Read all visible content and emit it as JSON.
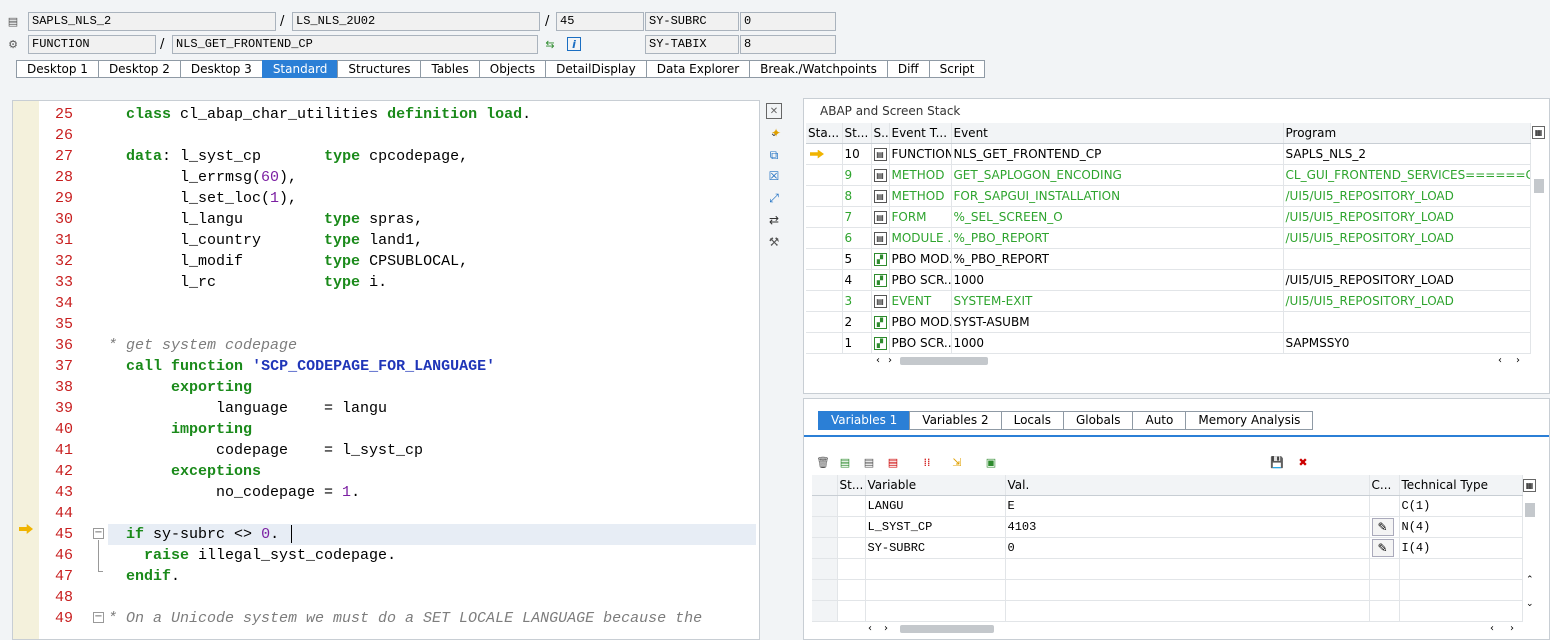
{
  "header": {
    "program": "SAPLS_NLS_2",
    "include": "LS_NLS_2U02",
    "line": "45",
    "subrc_label": "SY-SUBRC",
    "subrc_value": "0",
    "event_type": "FUNCTION",
    "event_name": "NLS_GET_FRONTEND_CP",
    "tabix_label": "SY-TABIX",
    "tabix_value": "8",
    "separator": "/"
  },
  "tabs": [
    "Desktop 1",
    "Desktop 2",
    "Desktop 3",
    "Standard",
    "Structures",
    "Tables",
    "Objects",
    "DetailDisplay",
    "Data Explorer",
    "Break./Watchpoints",
    "Diff",
    "Script"
  ],
  "active_tab": "Standard",
  "editor": {
    "current_line": 45,
    "lines": [
      {
        "n": "25",
        "t": "  class cl_abap_char_utilities definition load."
      },
      {
        "n": "26",
        "t": ""
      },
      {
        "n": "27",
        "t": "  data: l_syst_cp       type cpcodepage,"
      },
      {
        "n": "28",
        "t": "        l_errmsg(60),"
      },
      {
        "n": "29",
        "t": "        l_set_loc(1),"
      },
      {
        "n": "30",
        "t": "        l_langu         type spras,"
      },
      {
        "n": "31",
        "t": "        l_country       type land1,"
      },
      {
        "n": "32",
        "t": "        l_modif         type CPSUBLOCAL,"
      },
      {
        "n": "33",
        "t": "        l_rc            type i."
      },
      {
        "n": "34",
        "t": ""
      },
      {
        "n": "35",
        "t": ""
      },
      {
        "n": "36",
        "t": "* get system codepage"
      },
      {
        "n": "37",
        "t": "  call function 'SCP_CODEPAGE_FOR_LANGUAGE'"
      },
      {
        "n": "38",
        "t": "       exporting"
      },
      {
        "n": "39",
        "t": "            language    = langu"
      },
      {
        "n": "40",
        "t": "       importing"
      },
      {
        "n": "41",
        "t": "            codepage    = l_syst_cp"
      },
      {
        "n": "42",
        "t": "       exceptions"
      },
      {
        "n": "43",
        "t": "            no_codepage = 1."
      },
      {
        "n": "44",
        "t": ""
      },
      {
        "n": "45",
        "t": "  if sy-subrc <> 0."
      },
      {
        "n": "46",
        "t": "    raise illegal_syst_codepage."
      },
      {
        "n": "47",
        "t": "  endif."
      },
      {
        "n": "48",
        "t": ""
      },
      {
        "n": "49",
        "t": "* On a Unicode system we must do a SET LOCALE LANGUAGE because the"
      }
    ]
  },
  "stack": {
    "title": "ABAP and Screen Stack",
    "columns": [
      "Sta...",
      "St...",
      "S...",
      "Event T...",
      "Event",
      "Program"
    ],
    "rows": [
      {
        "sta": "arrow",
        "st": "10",
        "type": "FUNCTION",
        "event": "NLS_GET_FRONTEND_CP",
        "program": "SAPLS_NLS_2",
        "green": false
      },
      {
        "sta": "",
        "st": "9",
        "type": "METHOD",
        "event": "GET_SAPLOGON_ENCODING",
        "program": "CL_GUI_FRONTEND_SERVICES======CP",
        "green": true
      },
      {
        "sta": "",
        "st": "8",
        "type": "METHOD",
        "event": "FOR_SAPGUI_INSTALLATION",
        "program": "/UI5/UI5_REPOSITORY_LOAD",
        "green": true
      },
      {
        "sta": "",
        "st": "7",
        "type": "FORM",
        "event": "%_SEL_SCREEN_O",
        "program": "/UI5/UI5_REPOSITORY_LOAD",
        "green": true
      },
      {
        "sta": "",
        "st": "6",
        "type": "MODULE ...",
        "event": "%_PBO_REPORT",
        "program": "/UI5/UI5_REPOSITORY_LOAD",
        "green": true
      },
      {
        "sta": "",
        "st": "5",
        "type": "PBO MOD...",
        "event": "%_PBO_REPORT",
        "program": "",
        "green": false
      },
      {
        "sta": "",
        "st": "4",
        "type": "PBO SCR...",
        "event": "1000",
        "program": "/UI5/UI5_REPOSITORY_LOAD",
        "green": false
      },
      {
        "sta": "",
        "st": "3",
        "type": "EVENT",
        "event": "SYSTEM-EXIT",
        "program": "/UI5/UI5_REPOSITORY_LOAD",
        "green": true
      },
      {
        "sta": "",
        "st": "2",
        "type": "PBO MOD...",
        "event": "SYST-ASUBM",
        "program": "",
        "green": false
      },
      {
        "sta": "",
        "st": "1",
        "type": "PBO SCR...",
        "event": "1000",
        "program": "SAPMSSY0",
        "green": false
      }
    ]
  },
  "vartabs": [
    "Variables 1",
    "Variables 2",
    "Locals",
    "Globals",
    "Auto",
    "Memory Analysis"
  ],
  "active_vartab": "Variables 1",
  "vars": {
    "columns": [
      "St...",
      "Variable",
      "Val.",
      "C...",
      "Technical Type"
    ],
    "rows": [
      {
        "name": "LANGU",
        "value": "E",
        "edit": false,
        "type": "C(1)"
      },
      {
        "name": "L_SYST_CP",
        "value": "4103",
        "edit": true,
        "type": "N(4)"
      },
      {
        "name": "SY-SUBRC",
        "value": "0",
        "edit": true,
        "type": "I(4)"
      }
    ]
  },
  "colors": {
    "accent": "#2b7fd6",
    "keyword": "#1a8a1a",
    "line_number": "#c81e1e",
    "string": "#1f35b8",
    "green_row": "#2ea42e"
  }
}
